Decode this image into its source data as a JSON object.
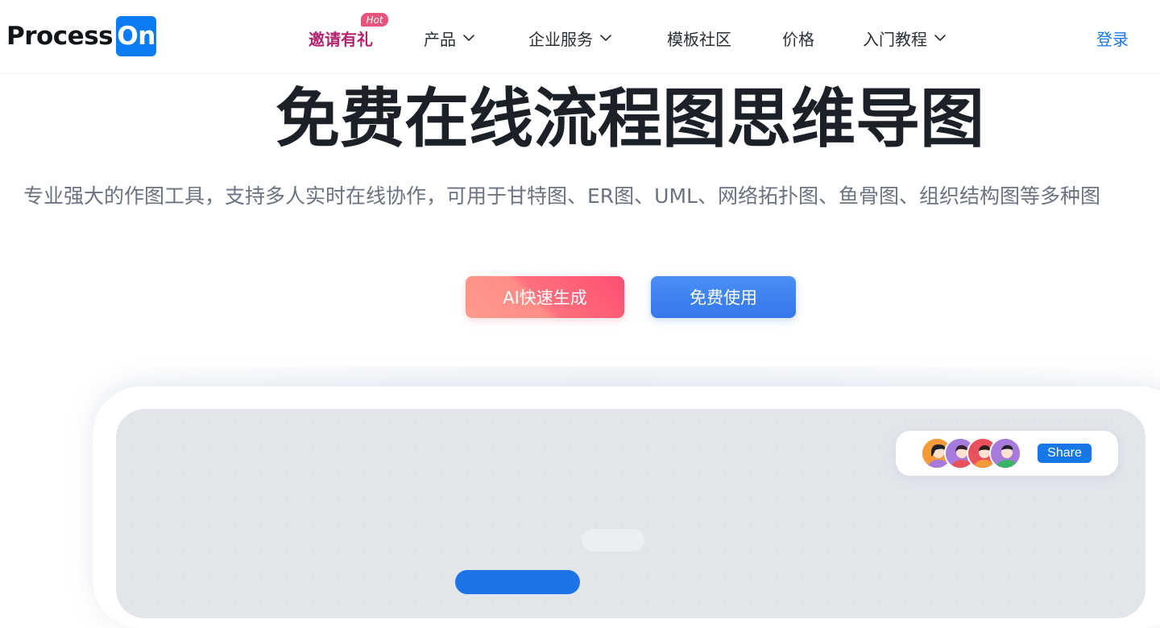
{
  "header": {
    "logo": {
      "text": "Process",
      "box_text": "On"
    },
    "nav": [
      {
        "label": "邀请有礼",
        "badge": "Hot",
        "has_dropdown": false
      },
      {
        "label": "产品",
        "has_dropdown": true
      },
      {
        "label": "企业服务",
        "has_dropdown": true
      },
      {
        "label": "模板社区",
        "has_dropdown": false
      },
      {
        "label": "价格",
        "has_dropdown": false
      },
      {
        "label": "入门教程",
        "has_dropdown": true
      }
    ],
    "login_label": "登录"
  },
  "hero": {
    "title": "免费在线流程图思维导图",
    "subtitle": "专业强大的作图工具，支持多人实时在线协作，可用于甘特图、ER图、UML、网络拓扑图、鱼骨图、组织结构图等多种图",
    "ai_button_label": "AI快速生成",
    "free_button_label": "免费使用"
  },
  "preview": {
    "share_button_label": "Share",
    "avatars": [
      "avatar-1",
      "avatar-2",
      "avatar-3",
      "avatar-4"
    ]
  },
  "colors": {
    "brand_blue": "#0d7cf2",
    "invite_magenta": "#b3246f",
    "hot_badge": "#e8557a",
    "link_blue": "#1677e6"
  },
  "icons": {
    "chevron": "chevron-down-icon"
  }
}
